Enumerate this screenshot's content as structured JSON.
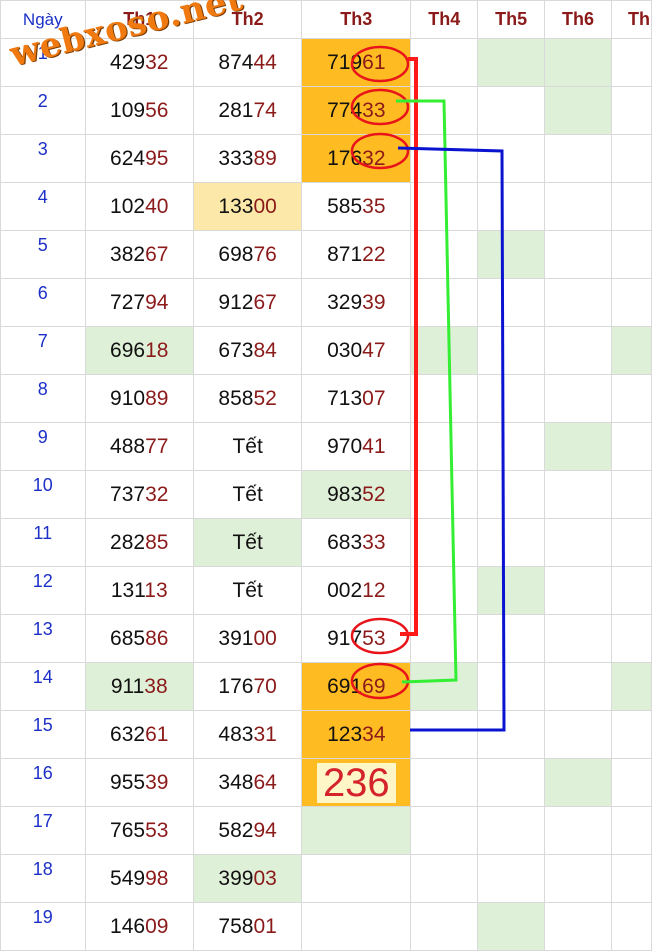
{
  "header": {
    "day": "Ngày",
    "cols": [
      "Th1",
      "Th2",
      "Th3",
      "Th4",
      "Th5",
      "Th6",
      "Th"
    ]
  },
  "watermark": "webxoso.net",
  "highlight_value": "236",
  "colors": {
    "green_cell": "#dff0d8",
    "yellow_cell": "#fce8a8",
    "orange_cell": "#ffbb22",
    "red_line": "#ff1a1a",
    "green_line": "#33ee33",
    "blue_line": "#0a14d0"
  },
  "rows": [
    {
      "day": "1",
      "th1": "42932",
      "th2": "87444",
      "th3": "71961"
    },
    {
      "day": "2",
      "th1": "10956",
      "th2": "28174",
      "th3": "77433"
    },
    {
      "day": "3",
      "th1": "62495",
      "th2": "33389",
      "th3": "17632"
    },
    {
      "day": "4",
      "th1": "10240",
      "th2": "13300",
      "th3": "58535"
    },
    {
      "day": "5",
      "th1": "38267",
      "th2": "69876",
      "th3": "87122"
    },
    {
      "day": "6",
      "th1": "72794",
      "th2": "91267",
      "th3": "32939"
    },
    {
      "day": "7",
      "th1": "69618",
      "th2": "67384",
      "th3": "03047"
    },
    {
      "day": "8",
      "th1": "91089",
      "th2": "85852",
      "th3": "71307"
    },
    {
      "day": "9",
      "th1": "48877",
      "th2": "Tết",
      "th3": "97041"
    },
    {
      "day": "10",
      "th1": "73732",
      "th2": "Tết",
      "th3": "98352"
    },
    {
      "day": "11",
      "th1": "28285",
      "th2": "Tết",
      "th3": "68333"
    },
    {
      "day": "12",
      "th1": "13113",
      "th2": "Tết",
      "th3": "00212"
    },
    {
      "day": "13",
      "th1": "68586",
      "th2": "39100",
      "th3": "91753"
    },
    {
      "day": "14",
      "th1": "91138",
      "th2": "17670",
      "th3": "69169"
    },
    {
      "day": "15",
      "th1": "63261",
      "th2": "48331",
      "th3": "12334"
    },
    {
      "day": "16",
      "th1": "95539",
      "th2": "34864",
      "th3": ""
    },
    {
      "day": "17",
      "th1": "76553",
      "th2": "58294",
      "th3": ""
    },
    {
      "day": "18",
      "th1": "54998",
      "th2": "39903",
      "th3": ""
    },
    {
      "day": "19",
      "th1": "14609",
      "th2": "75801",
      "th3": ""
    }
  ]
}
